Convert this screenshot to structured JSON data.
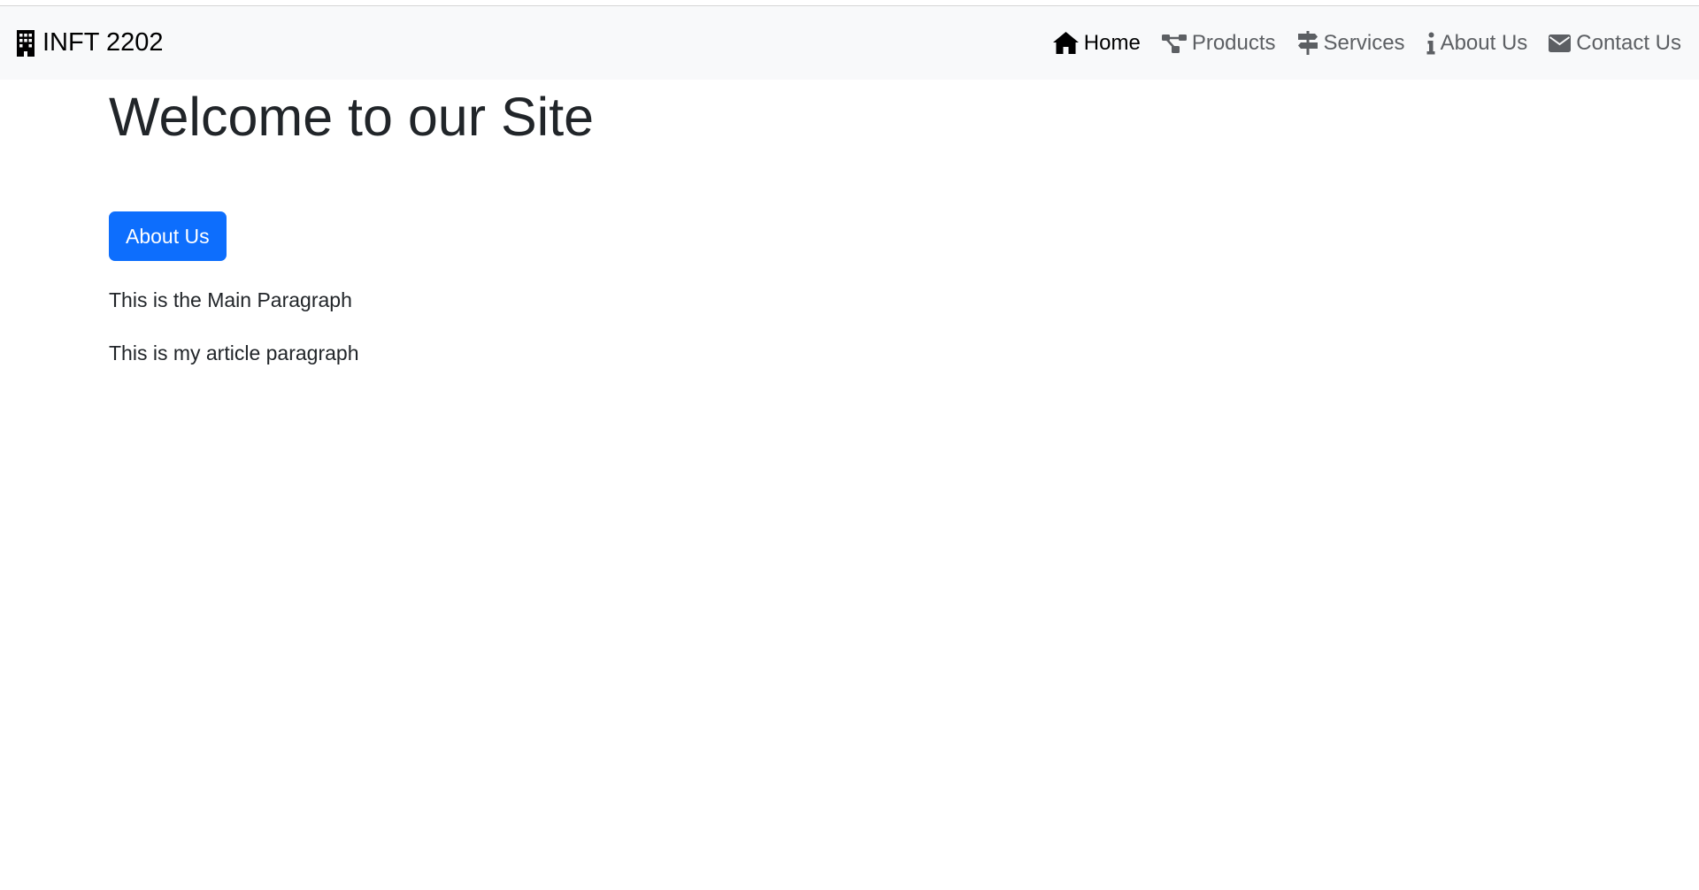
{
  "navbar": {
    "brand": {
      "label": "INFT 2202",
      "icon": "building-icon"
    },
    "links": [
      {
        "label": "Home",
        "icon": "home-icon",
        "active": true
      },
      {
        "label": "Products",
        "icon": "sitemap-icon",
        "active": false
      },
      {
        "label": "Services",
        "icon": "signs-post-icon",
        "active": false
      },
      {
        "label": "About Us",
        "icon": "info-icon",
        "active": false
      },
      {
        "label": "Contact Us",
        "icon": "envelope-icon",
        "active": false
      }
    ]
  },
  "main": {
    "title": "Welcome to our Site",
    "about_button_label": "About Us",
    "main_paragraph": "This is the Main Paragraph",
    "article_paragraph": "This is my article paragraph"
  },
  "colors": {
    "navbar_bg": "#f8f9fa",
    "primary": "#0d6efd",
    "active_link": "#000000",
    "inactive_link": "#5c5f63"
  }
}
